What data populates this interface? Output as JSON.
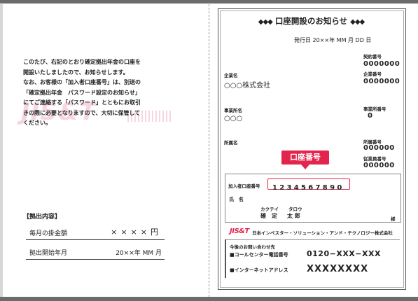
{
  "left_page": {
    "intro_lines": [
      "このたび、右記のとおり確定拠出年金の口座を",
      "開設いたしましたので、お知らせします。",
      "なお、お客様の「加入者口座番号」は、別送の",
      "「確定拠出年金　パスワード設定のお知らせ」",
      "にてご連絡する「パスワード」とともにお取引",
      "きの際に必要となりますので、大切に保管して",
      "ください。"
    ],
    "watermark": "JIS&T",
    "contribution_title": "【拠出内容】",
    "rows": [
      {
        "label": "毎月の掛金額",
        "value": "××××円"
      },
      {
        "label": "拠出開始年月",
        "value": "20××年 MM 月"
      }
    ]
  },
  "notice": {
    "title_decoration_left": "◆◆◆",
    "title": "口座開設のお知らせ",
    "title_decoration_right": "◆◆◆",
    "issue_date": "発行日 20××年 MM 月 DD 日",
    "contract_no_label": "契約番号",
    "contract_no": "0000000",
    "company_label": "企業名",
    "company_name": "○○○株式会社",
    "company_no_label": "企業番号",
    "company_no": "0000000",
    "office_label": "事業所名",
    "office_name": "○○○",
    "office_no_label": "事業所番号",
    "office_no": "0",
    "affiliation_label": "所属名",
    "affiliation_no_label": "所属番号",
    "affiliation_no": "000000",
    "employee_no_label": "従業員番号",
    "employee_no": "000000",
    "account_callout": "口座番号",
    "account_no_label": "加入者口座番号",
    "account_no": "1234567890",
    "name_label": "氏　名",
    "name_kana_family": "カクテイ",
    "name_kana_given": "タロウ",
    "name_family": "確　定",
    "name_given": "太 郎",
    "honorific": "様",
    "logo_text": "JIS&T",
    "company_footer": "日本インベスター・ソリューション・アンド・テクノロジー株式会社",
    "contact_title": "今後のお問い合わせ先",
    "call_center_label": "■コールセンター電話番号",
    "call_center_no": "0120−XXX−XXX",
    "web_label": "■インターネットアドレス",
    "web_address": "XXXXXXXX"
  }
}
